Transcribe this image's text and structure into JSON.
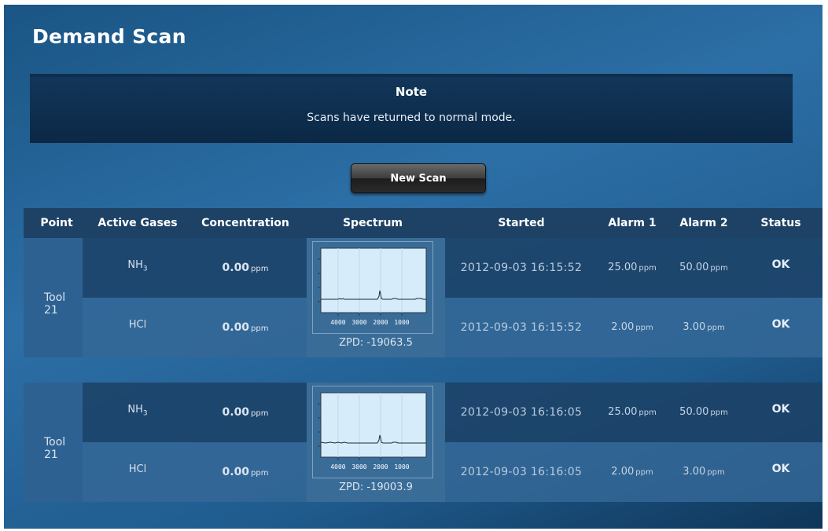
{
  "title": "Demand Scan",
  "note": {
    "heading": "Note",
    "message": "Scans have returned to normal mode."
  },
  "new_scan_label": "New Scan",
  "columns": [
    "Point",
    "Active Gases",
    "Concentration",
    "Spectrum",
    "Started",
    "Alarm 1",
    "Alarm 2",
    "Status"
  ],
  "groups": [
    {
      "point": "Tool 21",
      "zpd": "ZPD: -19063.5",
      "spectrum_ticks": [
        "4000",
        "3000",
        "2000",
        "1000"
      ],
      "rows": [
        {
          "gas": "NH",
          "gas_sub": "3",
          "conc": "0.00",
          "conc_unit": "ppm",
          "started": "2012-09-03 16:15:52",
          "alarm1": "25.00",
          "alarm1_unit": "ppm",
          "alarm2": "50.00",
          "alarm2_unit": "ppm",
          "status": "OK"
        },
        {
          "gas": "HCl",
          "gas_sub": "",
          "conc": "0.00",
          "conc_unit": "ppm",
          "started": "2012-09-03 16:15:52",
          "alarm1": "2.00",
          "alarm1_unit": "ppm",
          "alarm2": "3.00",
          "alarm2_unit": "ppm",
          "status": "OK"
        }
      ]
    },
    {
      "point": "Tool 21",
      "zpd": "ZPD: -19003.9",
      "spectrum_ticks": [
        "4000",
        "3000",
        "2000",
        "1000"
      ],
      "rows": [
        {
          "gas": "NH",
          "gas_sub": "3",
          "conc": "0.00",
          "conc_unit": "ppm",
          "started": "2012-09-03 16:16:05",
          "alarm1": "25.00",
          "alarm1_unit": "ppm",
          "alarm2": "50.00",
          "alarm2_unit": "ppm",
          "status": "OK"
        },
        {
          "gas": "HCl",
          "gas_sub": "",
          "conc": "0.00",
          "conc_unit": "ppm",
          "started": "2012-09-03 16:16:05",
          "alarm1": "2.00",
          "alarm1_unit": "ppm",
          "alarm2": "3.00",
          "alarm2_unit": "ppm",
          "status": "OK"
        }
      ]
    }
  ],
  "colors": {
    "panel_bg": "#2c6fa6",
    "note_bg": "#0b2845",
    "header_bg": "#1d4266",
    "spectrum_plot_bg": "#d6ecfa"
  }
}
